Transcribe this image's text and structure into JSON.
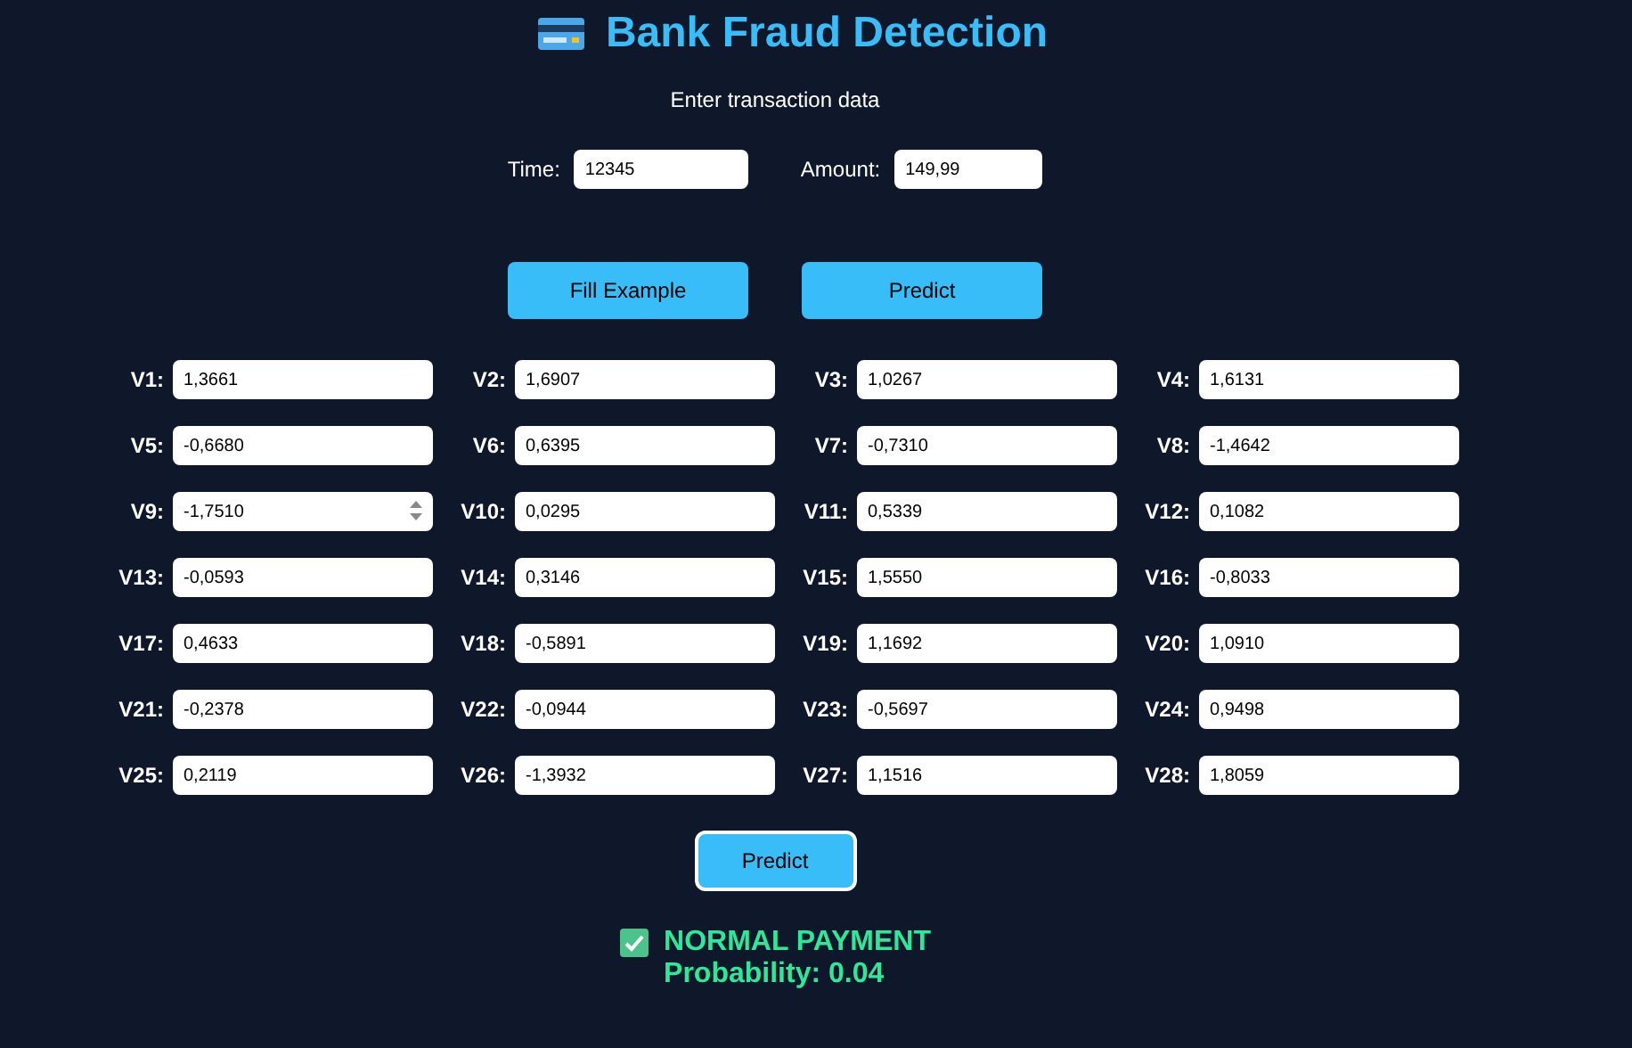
{
  "title": "Bank Fraud Detection",
  "subtitle": "Enter transaction data",
  "top_fields": [
    {
      "label": "Time:",
      "value": "12345"
    },
    {
      "label": "Amount:",
      "value": "149,99"
    }
  ],
  "top_buttons": [
    "Fill Example",
    "Predict"
  ],
  "features": [
    {
      "label": "V1:",
      "value": "1,3661",
      "hovered": false
    },
    {
      "label": "V2:",
      "value": "1,6907",
      "hovered": false
    },
    {
      "label": "V3:",
      "value": "1,0267",
      "hovered": false
    },
    {
      "label": "V4:",
      "value": "1,6131",
      "hovered": false
    },
    {
      "label": "V5:",
      "value": "-0,6680",
      "hovered": false
    },
    {
      "label": "V6:",
      "value": "0,6395",
      "hovered": false
    },
    {
      "label": "V7:",
      "value": "-0,7310",
      "hovered": false
    },
    {
      "label": "V8:",
      "value": "-1,4642",
      "hovered": false
    },
    {
      "label": "V9:",
      "value": "-1,7510",
      "hovered": true
    },
    {
      "label": "V10:",
      "value": "0,0295",
      "hovered": false
    },
    {
      "label": "V11:",
      "value": "0,5339",
      "hovered": false
    },
    {
      "label": "V12:",
      "value": "0,1082",
      "hovered": false
    },
    {
      "label": "V13:",
      "value": "-0,0593",
      "hovered": false
    },
    {
      "label": "V14:",
      "value": "0,3146",
      "hovered": false
    },
    {
      "label": "V15:",
      "value": "1,5550",
      "hovered": false
    },
    {
      "label": "V16:",
      "value": "-0,8033",
      "hovered": false
    },
    {
      "label": "V17:",
      "value": "0,4633",
      "hovered": false
    },
    {
      "label": "V18:",
      "value": "-0,5891",
      "hovered": false
    },
    {
      "label": "V19:",
      "value": "1,1692",
      "hovered": false
    },
    {
      "label": "V20:",
      "value": "1,0910",
      "hovered": false
    },
    {
      "label": "V21:",
      "value": "-0,2378",
      "hovered": false
    },
    {
      "label": "V22:",
      "value": "-0,0944",
      "hovered": false
    },
    {
      "label": "V23:",
      "value": "-0,5697",
      "hovered": false
    },
    {
      "label": "V24:",
      "value": "0,9498",
      "hovered": false
    },
    {
      "label": "V25:",
      "value": "0,2119",
      "hovered": false
    },
    {
      "label": "V26:",
      "value": "-1,3932",
      "hovered": false
    },
    {
      "label": "V27:",
      "value": "1,1516",
      "hovered": false
    },
    {
      "label": "V28:",
      "value": "1,8059",
      "hovered": false
    }
  ],
  "predict_button": {
    "label": "Predict",
    "focused": true
  },
  "result": {
    "kind": "normal",
    "verdict": "NORMAL PAYMENT",
    "probability": "Probability: 0.04"
  }
}
